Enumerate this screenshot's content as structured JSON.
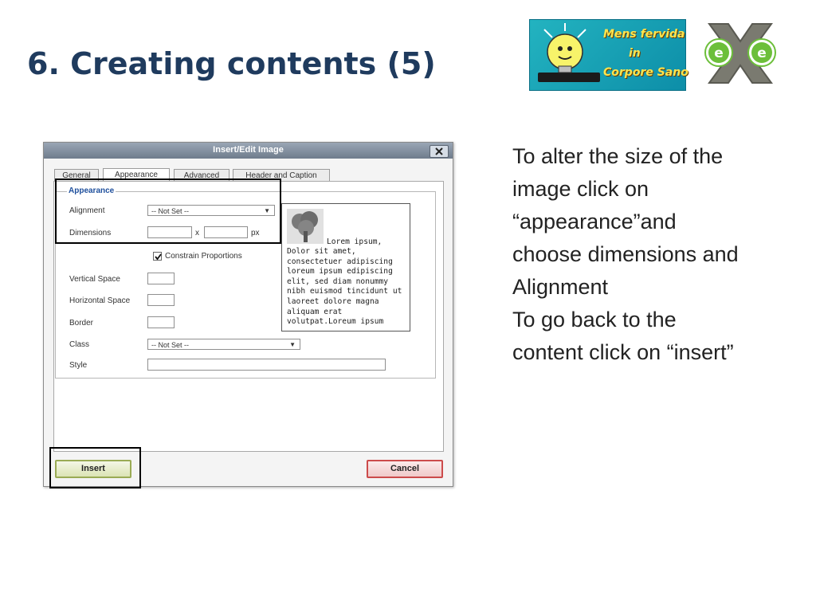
{
  "slide": {
    "title": "6. Creating contents (5)"
  },
  "logos": {
    "mens": {
      "line1": "Mens fervida",
      "line2": "in",
      "line3": "Corpore Sano"
    },
    "exe_icon": "exe-logo-icon"
  },
  "dialog": {
    "title": "Insert/Edit Image",
    "close_icon": "close-icon",
    "tabs": [
      {
        "label": "General"
      },
      {
        "label": "Appearance"
      },
      {
        "label": "Advanced"
      },
      {
        "label": "Header and Caption"
      }
    ],
    "active_tab": "Appearance",
    "fieldset_legend": "Appearance",
    "fields": {
      "alignment": {
        "label": "Alignment",
        "value": "-- Not Set --"
      },
      "dimensions": {
        "label": "Dimensions",
        "width": "",
        "separator": "x",
        "height": "",
        "unit": "px"
      },
      "constrain": {
        "label": "Constrain Proportions",
        "checked": true
      },
      "vspace": {
        "label": "Vertical Space",
        "value": ""
      },
      "hspace": {
        "label": "Horizontal Space",
        "value": ""
      },
      "border": {
        "label": "Border",
        "value": ""
      },
      "class": {
        "label": "Class",
        "value": "-- Not Set --"
      },
      "style": {
        "label": "Style",
        "value": ""
      }
    },
    "preview": {
      "first_line": "Lorem ipsum,",
      "body": "Dolor sit amet,\nconsectetuer adipiscing\nloreum ipsum edipiscing\nelit, sed diam nonummy\nnibh euismod tincidunt ut\nlaoreet dolore magna\naliquam erat\nvolutpat.Loreum ipsum"
    },
    "buttons": {
      "insert": "Insert",
      "cancel": "Cancel"
    }
  },
  "instructions": [
    "To alter the size of the",
    "image click on",
    "“appearance”and",
    "choose dimensions and",
    "Alignment",
    "To go back to the",
    "content click on “insert”"
  ],
  "colors": {
    "title": "#1f3b5e",
    "legend": "#1e4f9c",
    "insert_border": "#9aab55",
    "cancel_border": "#cc4b4b"
  }
}
